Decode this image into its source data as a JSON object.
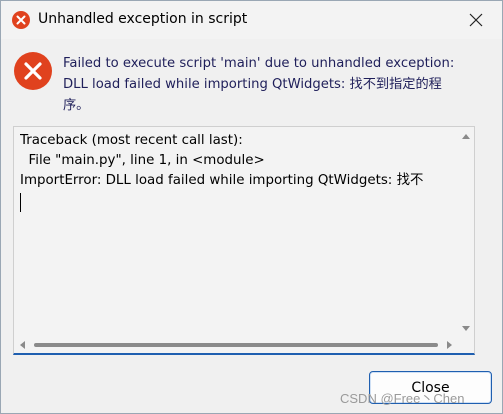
{
  "window": {
    "title": "Unhandled exception in script",
    "accent": "#1f5fb0",
    "error_color": "#e0421e"
  },
  "message": {
    "line1": "Failed to execute script 'main' due to unhandled exception:",
    "line2": "DLL load failed while importing QtWidgets: 找不到指定的程",
    "line3": "序。"
  },
  "traceback": {
    "lines": [
      "Traceback (most recent call last):",
      "  File \"main.py\", line 1, in <module>",
      "ImportError: DLL load failed while importing QtWidgets: 找不"
    ]
  },
  "buttons": {
    "close_label": "Close"
  },
  "watermark": "CSDN @Free丶Chen"
}
